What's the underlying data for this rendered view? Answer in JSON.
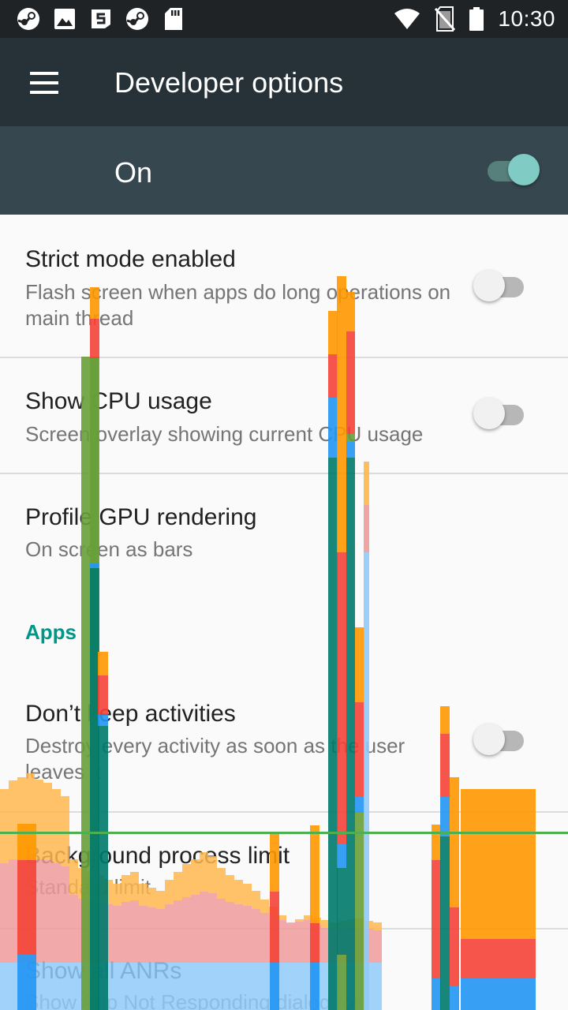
{
  "status_bar": {
    "time": "10:30",
    "left_icons": [
      "steam-icon",
      "image-icon",
      "swiftkey-icon",
      "steam-icon",
      "sd-card-icon"
    ],
    "right_icons": [
      "wifi-icon",
      "no-sim-icon",
      "battery-icon"
    ]
  },
  "app_bar": {
    "title": "Developer options",
    "menu_icon": "hamburger-menu-icon"
  },
  "master_switch": {
    "label": "On",
    "state": "on"
  },
  "settings": [
    {
      "title": "Strict mode enabled",
      "summary": "Flash screen when apps do long operations on main thread",
      "toggle": "off"
    },
    {
      "title": "Show CPU usage",
      "summary": "Screen overlay showing current CPU usage",
      "toggle": "off"
    },
    {
      "title": "Profile GPU rendering",
      "summary": "On screen as bars"
    },
    {
      "section": "Apps"
    },
    {
      "title": "Don’t keep activities",
      "summary": "Destroy every activity as soon as the user leaves it",
      "toggle": "off"
    },
    {
      "title": "Background process limit",
      "summary": "Standard limit"
    },
    {
      "title": "Show all ANRs",
      "summary": "Show App Not Responding dialog for"
    }
  ],
  "gpu_overlay": {
    "type": "profile-gpu-rendering-bars",
    "colors": {
      "swap": "#ff9800",
      "command_issue": "#f44336",
      "upload": "#2196f3",
      "draw": "#00796b",
      "measure_layout": "#689f38",
      "input": "#4caf50",
      "light_swap": "#ffb74d",
      "light_command": "#ef9a9a",
      "light_upload": "#90caf9",
      "threshold_line": "#4caf50"
    }
  }
}
